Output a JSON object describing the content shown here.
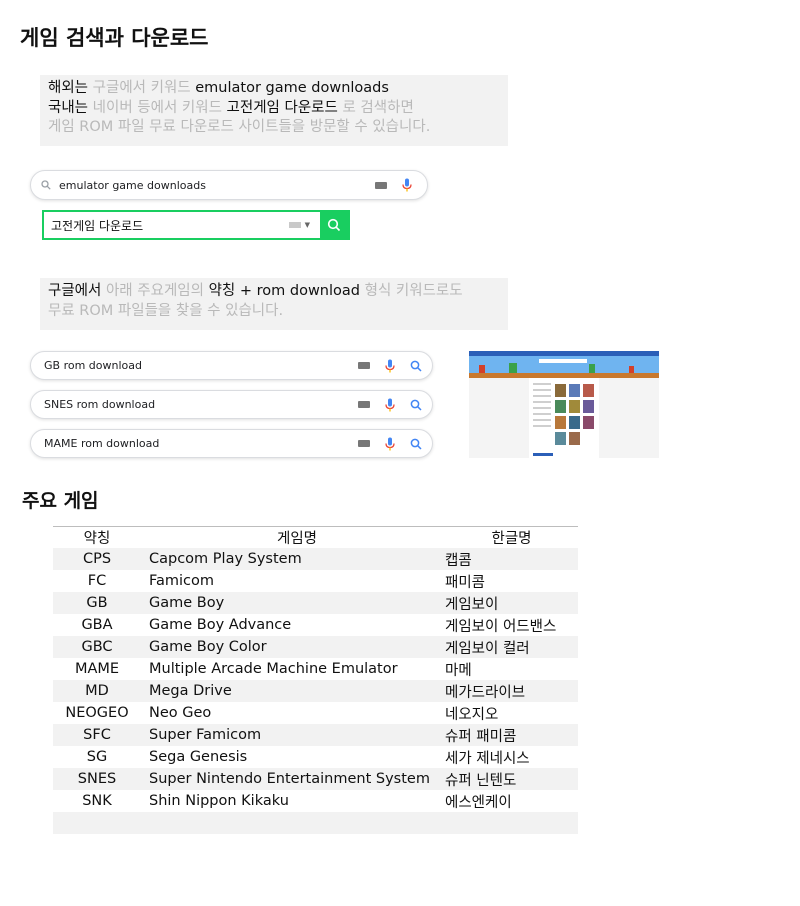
{
  "heading_search": "게임 검색과 다운로드",
  "note1": {
    "l1_a": "해외는 ",
    "l1_b": "구글에서 키워드 ",
    "l1_c": "emulator game downloads",
    "l2_a": "국내는 ",
    "l2_b": "네이버 등에서 키워드 ",
    "l2_c": "고전게임 다운로드",
    "l2_d": " 로 검색하면",
    "l3": "게임 ROM 파일 무료 다운로드 사이트들을 방문할 수 있습니다."
  },
  "google_search": {
    "query": "emulator game downloads"
  },
  "naver_search": {
    "query": "고전게임 다운로드"
  },
  "note2": {
    "l1_a": "구글에서 ",
    "l1_b": "아래 주요게임의 ",
    "l1_c": "약칭 + rom download",
    "l1_d": " 형식 키워드로도",
    "l2": "무료 ROM 파일들을 찾을 수 있습니다."
  },
  "rom_searches": [
    "GB rom download",
    "SNES rom download",
    "MAME rom download"
  ],
  "heading_games": "주요 게임",
  "games_table": {
    "headers": [
      "약칭",
      "게임명",
      "한글명"
    ],
    "rows": [
      [
        "CPS",
        "Capcom Play System",
        "캡콤"
      ],
      [
        "FC",
        "Famicom",
        "패미콤"
      ],
      [
        "GB",
        "Game Boy",
        "게임보이"
      ],
      [
        "GBA",
        "Game Boy Advance",
        "게임보이 어드밴스"
      ],
      [
        "GBC",
        "Game Boy Color",
        "게임보이 컬러"
      ],
      [
        "MAME",
        "Multiple Arcade Machine Emulator",
        "마메"
      ],
      [
        "MD",
        "Mega Drive",
        "메가드라이브"
      ],
      [
        "NEOGEO",
        "Neo Geo",
        "네오지오"
      ],
      [
        "SFC",
        "Super Famicom",
        "슈퍼 패미콤"
      ],
      [
        "SG",
        "Sega Genesis",
        "세가 제네시스"
      ],
      [
        "SNES",
        "Super Nintendo Entertainment System",
        "슈퍼 닌텐도"
      ],
      [
        "SNK",
        "Shin Nippon Kikaku",
        "에스엔케이"
      ]
    ]
  },
  "colors": {
    "naver_green": "#19ce60",
    "google_blue": "#4285f4",
    "note_bg": "#f2f2f2"
  }
}
